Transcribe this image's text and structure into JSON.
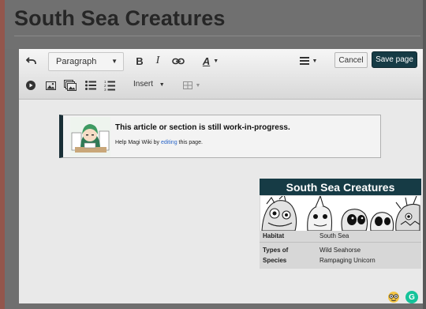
{
  "page": {
    "title": "South Sea Creatures"
  },
  "toolbar": {
    "paragraph_label": "Paragraph",
    "bold_label": "B",
    "italic_label": "I",
    "text_style_label": "A",
    "insert_label": "Insert",
    "cancel_label": "Cancel",
    "save_label": "Save page"
  },
  "notice": {
    "title": "This article or section is still work-in-progress.",
    "text_before": "Help Magi Wiki by ",
    "link_text": "editing",
    "text_after": " this page."
  },
  "infobox": {
    "title": "South Sea Creatures",
    "rows": [
      {
        "key": "Habitat",
        "value": "South Sea"
      },
      {
        "key": "Types of",
        "value": "Wild Seahorse"
      },
      {
        "key": "Species",
        "value": "Rampaging Unicorn"
      }
    ]
  },
  "colors": {
    "accent": "#163b45",
    "link": "#2a66c8",
    "grammarly": "#15c39a"
  }
}
